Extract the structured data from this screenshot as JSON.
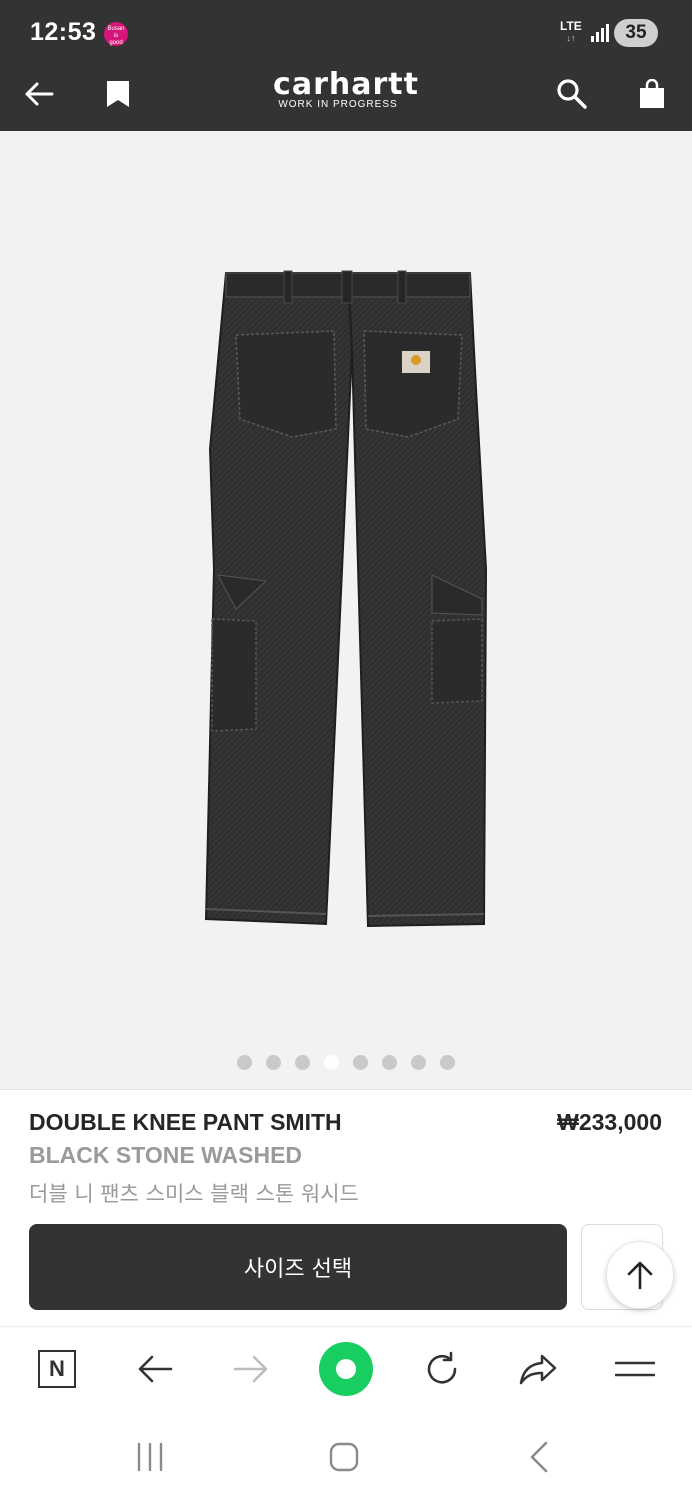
{
  "status_bar": {
    "time": "12:53",
    "badge_text": "Busan is good",
    "network": "LTE",
    "battery": "35"
  },
  "header": {
    "brand": "carhartt",
    "brand_sub": "WORK IN PROGRESS",
    "icons": [
      "back-arrow-icon",
      "bookmark-icon",
      "search-icon",
      "shopping-bag-icon"
    ]
  },
  "gallery": {
    "total_slides": 8,
    "active_index": 3
  },
  "product": {
    "name": "DOUBLE KNEE PANT SMITH",
    "color": "BLACK STONE WASHED",
    "name_ko": "더블 니 팬츠 스미스 블랙 스톤 워시드",
    "price": "₩233,000"
  },
  "actions": {
    "size_select": "사이즈 선택"
  },
  "browser_toolbar": {
    "icons": [
      "naver-n-icon",
      "back-arrow-icon",
      "forward-arrow-icon",
      "green-home-icon",
      "refresh-icon",
      "share-icon",
      "menu-icon"
    ]
  },
  "colors": {
    "header_bg": "#333333",
    "image_bg": "#f2f2f2",
    "accent_green": "#19ce60",
    "text_dark": "#262626",
    "text_muted": "#9a9a9a"
  }
}
